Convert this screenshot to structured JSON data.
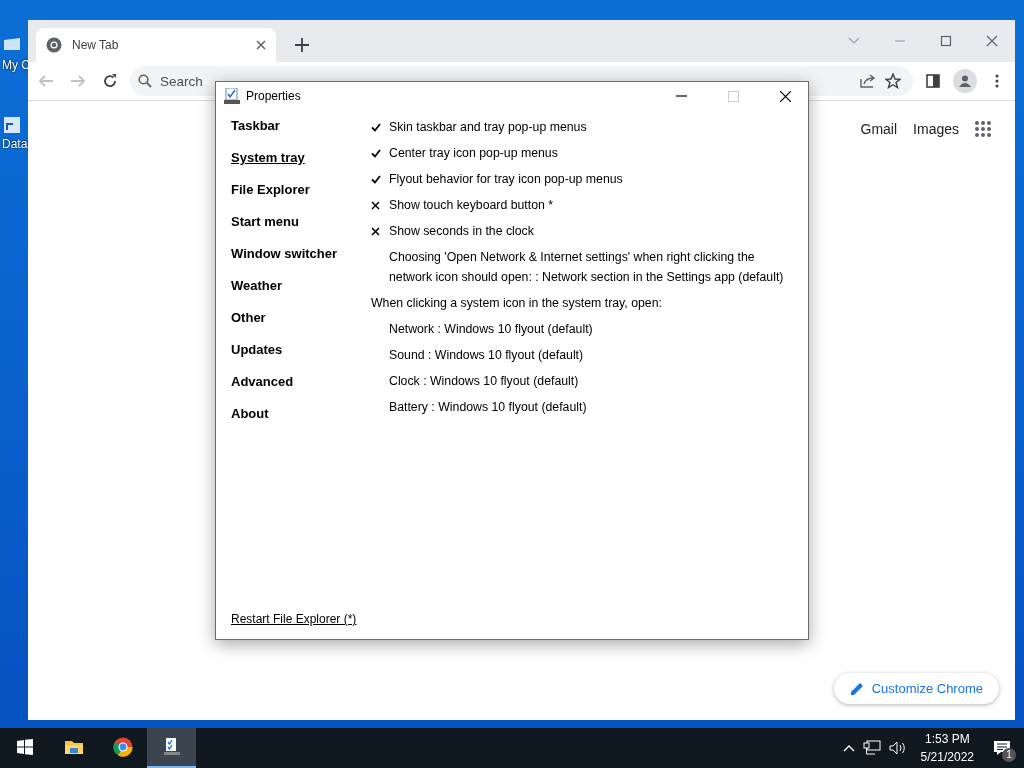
{
  "desktop": {
    "icons": [
      {
        "label": "My C"
      },
      {
        "label": "Data"
      }
    ]
  },
  "browser": {
    "tab": {
      "title": "New Tab"
    },
    "omnibox": {
      "placeholder": "Search"
    },
    "links": [
      "Gmail",
      "Images"
    ],
    "customize_button": "Customize Chrome"
  },
  "dialog": {
    "title": "Properties",
    "sidebar": {
      "items": [
        {
          "label": "Taskbar",
          "selected": false
        },
        {
          "label": "System tray",
          "selected": true
        },
        {
          "label": "File Explorer",
          "selected": false
        },
        {
          "label": "Start menu",
          "selected": false
        },
        {
          "label": "Window switcher",
          "selected": false
        },
        {
          "label": "Weather",
          "selected": false
        },
        {
          "label": "Other",
          "selected": false
        },
        {
          "label": "Updates",
          "selected": false
        },
        {
          "label": "Advanced",
          "selected": false
        },
        {
          "label": "About",
          "selected": false
        }
      ]
    },
    "options": [
      {
        "kind": "toggle",
        "checked": true,
        "label": "Skin taskbar and tray pop-up menus"
      },
      {
        "kind": "toggle",
        "checked": true,
        "label": "Center tray icon pop-up menus"
      },
      {
        "kind": "toggle",
        "checked": true,
        "label": "Flyout behavior for tray icon pop-up menus"
      },
      {
        "kind": "toggle",
        "checked": false,
        "label": "Show touch keyboard button *"
      },
      {
        "kind": "toggle",
        "checked": false,
        "label": "Show seconds in the clock"
      },
      {
        "kind": "choice",
        "label": "Choosing 'Open Network & Internet settings' when right clicking the network icon should open: : Network section in the Settings app (default)"
      },
      {
        "kind": "heading",
        "label": "When clicking a system icon in the system tray, open:"
      },
      {
        "kind": "choice",
        "label": "Network : Windows 10 flyout (default)"
      },
      {
        "kind": "choice",
        "label": "Sound : Windows 10 flyout (default)"
      },
      {
        "kind": "choice",
        "label": "Clock : Windows 10 flyout (default)"
      },
      {
        "kind": "choice",
        "label": "Battery : Windows 10 flyout (default)"
      }
    ],
    "footer_link": "Restart File Explorer (*)"
  },
  "taskbar": {
    "apps": [
      {
        "kind": "folder",
        "active": false
      },
      {
        "kind": "browser",
        "active": false
      },
      {
        "kind": "settings",
        "active": true
      }
    ],
    "clock": {
      "time": "1:53 PM",
      "date": "5/21/2022"
    },
    "notification_count": "1"
  }
}
